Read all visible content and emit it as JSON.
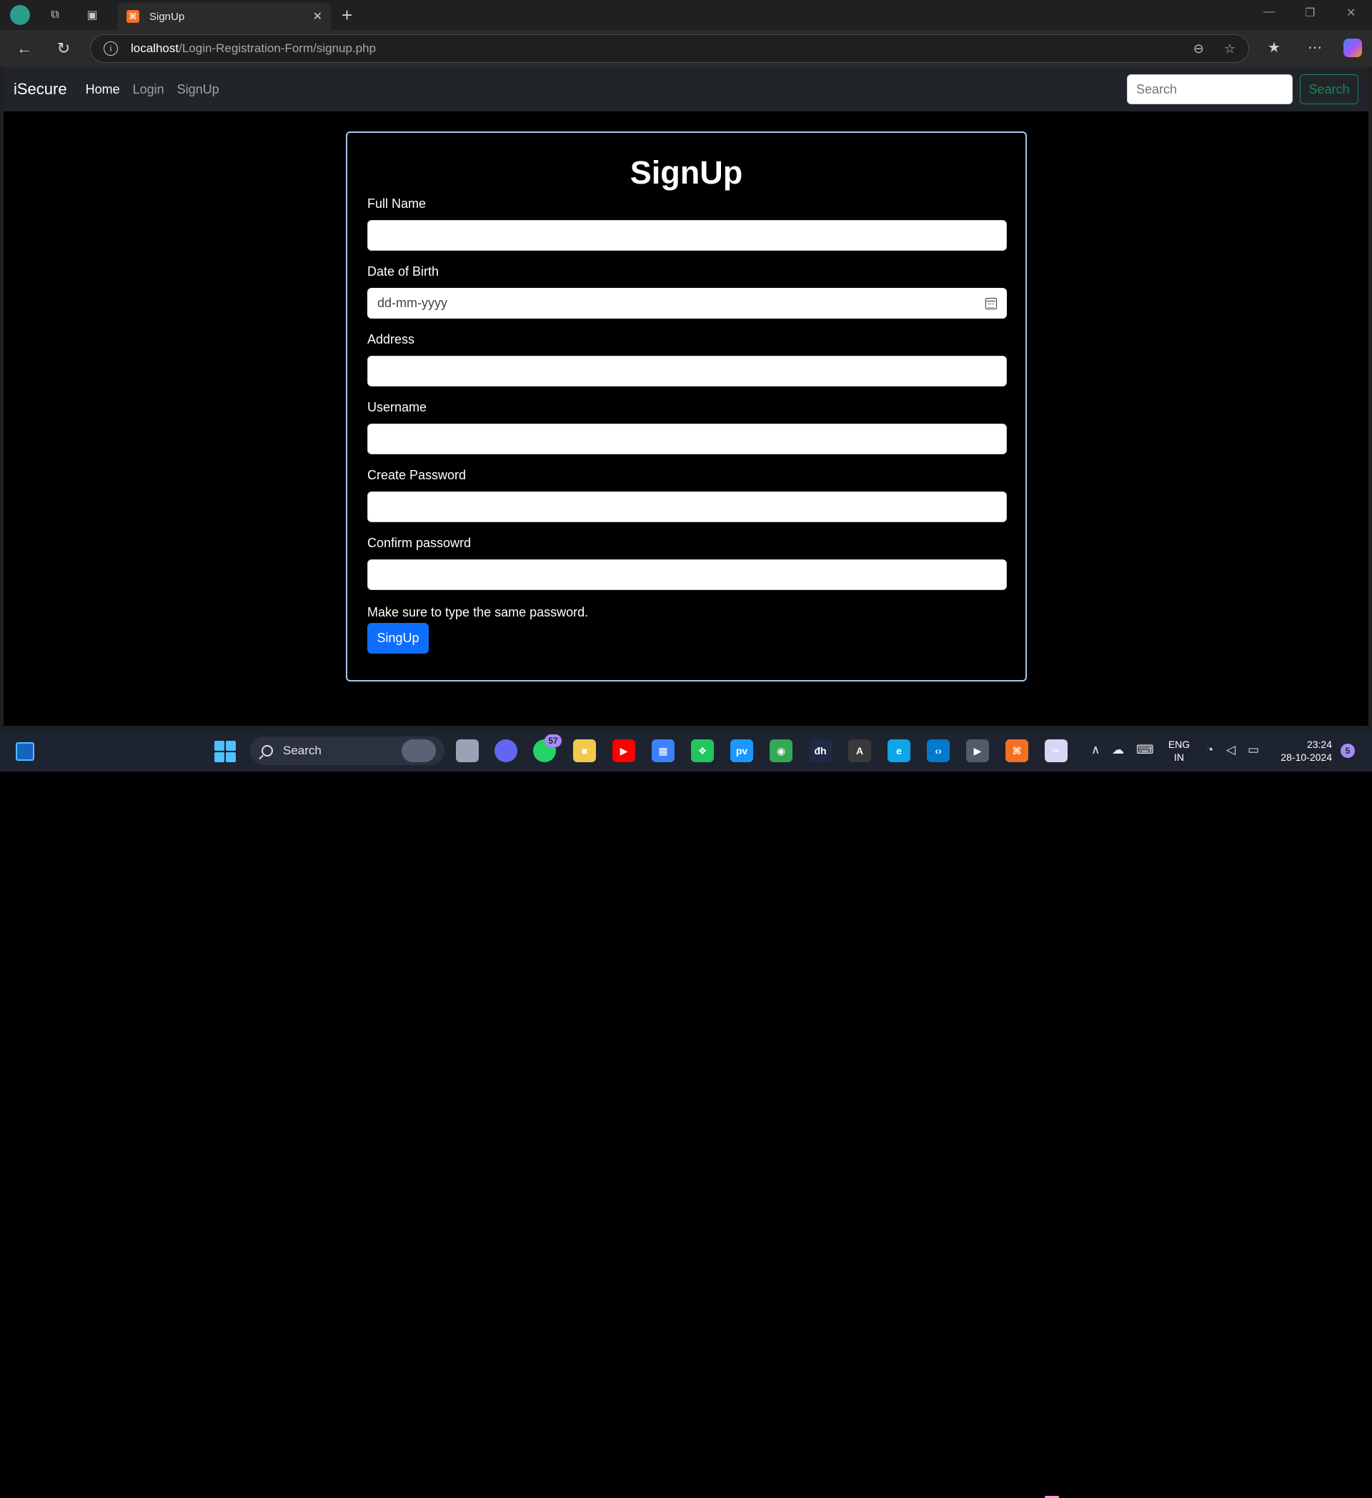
{
  "browser": {
    "tab_title": "SignUp",
    "tab_favicon_text": "⌘",
    "tab_close": "✕",
    "new_tab": "+",
    "url_host": "localhost",
    "url_path": "/Login-Registration-Form/signup.php",
    "info_icon_text": "i",
    "window_minimize": "—",
    "window_restore": "❐",
    "window_close": "✕",
    "back_glyph": "←",
    "reload_glyph": "↻",
    "zoom_glyph": "⊖",
    "star_glyph": "☆",
    "favorites_glyph": "★",
    "more_glyph": "⋯"
  },
  "navbar": {
    "brand": "iSecure",
    "links": [
      {
        "label": "Home",
        "active": true
      },
      {
        "label": "Login",
        "active": false
      },
      {
        "label": "SignUp",
        "active": false
      }
    ],
    "search_placeholder": "Search",
    "search_button": "Search",
    "search_button_color": "#198754"
  },
  "form": {
    "title": "SignUp",
    "fields": {
      "full_name": {
        "label": "Full Name",
        "value": ""
      },
      "dob": {
        "label": "Date of Birth",
        "placeholder": "dd-mm-yyyy"
      },
      "address": {
        "label": "Address",
        "value": ""
      },
      "username": {
        "label": "Username",
        "value": ""
      },
      "password": {
        "label": "Create Password",
        "value": ""
      },
      "confirm_password": {
        "label": "Confirm passowrd",
        "value": ""
      }
    },
    "help_text": "Make sure to type the same password.",
    "submit_label": "SingUp",
    "submit_color": "#0d6efd"
  },
  "taskbar": {
    "search_label": "Search",
    "whatsapp_badge": "57",
    "apps": [
      {
        "name": "file-explorer-icon",
        "color": "#f2c94c",
        "glyph": "■"
      },
      {
        "name": "youtube-icon",
        "color": "#ff0000",
        "glyph": "▶"
      },
      {
        "name": "store-icon",
        "color": "#3b82f6",
        "glyph": "▦"
      },
      {
        "name": "app-green-icon",
        "color": "#22c55e",
        "glyph": "❖"
      },
      {
        "name": "prime-video-icon",
        "color": "#1a98ff",
        "glyph": "pv"
      },
      {
        "name": "chrome-icon",
        "color": "#34a853",
        "glyph": "◉"
      },
      {
        "name": "devhub-icon",
        "color": "#1f2a44",
        "glyph": "đh"
      },
      {
        "name": "font-app-icon",
        "color": "#3a3a3a",
        "glyph": "A"
      },
      {
        "name": "edge-icon",
        "color": "#0ea5e9",
        "glyph": "e"
      },
      {
        "name": "vscode-icon",
        "color": "#007acc",
        "glyph": "‹›"
      },
      {
        "name": "media-player-icon",
        "color": "#555b66",
        "glyph": "▶"
      },
      {
        "name": "xampp-icon",
        "color": "#f37021",
        "glyph": "⌘"
      },
      {
        "name": "snipping-tool-icon",
        "color": "#d6d6f5",
        "glyph": "✂"
      }
    ],
    "language_top": "ENG",
    "language_bottom": "IN",
    "time": "23:24",
    "date": "28-10-2024",
    "notification_count": "5",
    "tray_chevron": "∧",
    "tray_wifi": "◔",
    "tray_volume": "◁",
    "tray_battery": "▭"
  }
}
